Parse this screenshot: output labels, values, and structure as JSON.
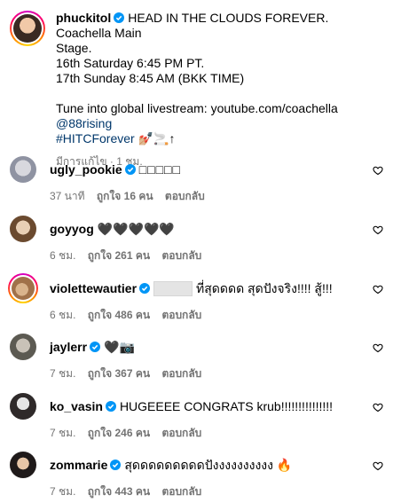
{
  "post": {
    "username": "phuckitol",
    "caption_line1": "HEAD IN THE CLOUDS FOREVER. Coachella Main",
    "caption_line2": "Stage.",
    "caption_line3": "16th Saturday 6:45 PM PT.",
    "caption_line4": "17th Sunday 8:45 AM (BKK TIME)",
    "caption_line5_prefix": "Tune into global livestream: youtube.com/coachella",
    "mention": "@88rising",
    "hashtag": "#HITCForever",
    "hashtag_suffix": "💅🏼🚬↑",
    "meta": "มีการแก้ไข · 1 ชม."
  },
  "comments": [
    {
      "username": "ugly_pookie",
      "text": "□□□□□",
      "time": "37 นาที",
      "likes": "ถูกใจ 16 คน",
      "reply": "ตอบกลับ"
    },
    {
      "username": "goyyog",
      "text": "🖤🖤🖤🖤🖤",
      "time": "6 ชม.",
      "likes": "ถูกใจ 261 คน",
      "reply": "ตอบกลับ"
    },
    {
      "username": "violettewautier",
      "text": "ที่สุดดดด สุดปังจริง!!!! สู้!!!",
      "time": "6 ชม.",
      "likes": "ถูกใจ 486 คน",
      "reply": "ตอบกลับ"
    },
    {
      "username": "jaylerr",
      "text": "🖤📷",
      "time": "7 ชม.",
      "likes": "ถูกใจ 367 คน",
      "reply": "ตอบกลับ"
    },
    {
      "username": "ko_vasin",
      "text": "HUGEEEE CONGRATS krub!!!!!!!!!!!!!!!",
      "time": "7 ชม.",
      "likes": "ถูกใจ 246 คน",
      "reply": "ตอบกลับ"
    },
    {
      "username": "zommarie",
      "text": "สุดดดดดดดดดปังงงงงงงงงง 🔥",
      "time": "7 ชม.",
      "likes": "ถูกใจ 443 คน",
      "reply": "ตอบกลับ"
    }
  ],
  "colors": {
    "verified": "#0095f6",
    "link": "#00376b",
    "secondary_text": "#737373"
  },
  "icons": {
    "verified": "verified-badge-icon",
    "like": "heart-outline-icon"
  }
}
